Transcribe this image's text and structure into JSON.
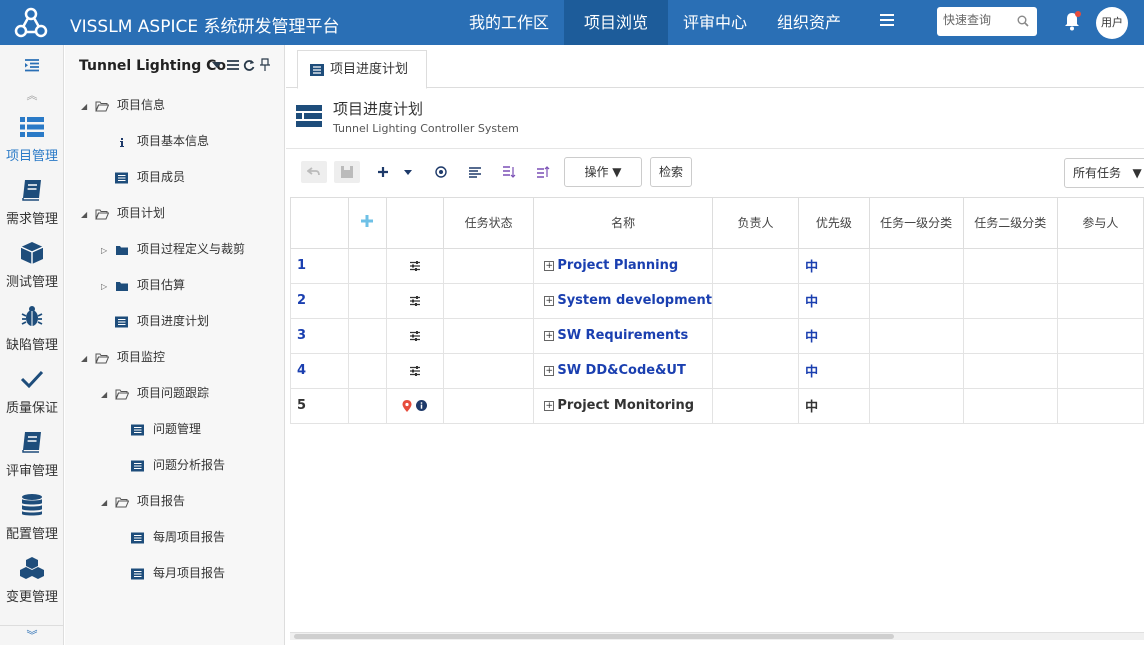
{
  "app": {
    "title": "VISSLM ASPICE 系统研发管理平台"
  },
  "nav": [
    {
      "label": "我的工作区",
      "active": false
    },
    {
      "label": "项目浏览",
      "active": true
    },
    {
      "label": "评审中心",
      "active": false
    },
    {
      "label": "组织资产",
      "active": false
    }
  ],
  "search": {
    "placeholder": "快速查询"
  },
  "user": {
    "label": "用户"
  },
  "modules": [
    {
      "label": "项目管理",
      "icon": "list-icon",
      "active": true
    },
    {
      "label": "需求管理",
      "icon": "book-icon",
      "active": false
    },
    {
      "label": "测试管理",
      "icon": "cube-icon",
      "active": false
    },
    {
      "label": "缺陷管理",
      "icon": "bug-icon",
      "active": false
    },
    {
      "label": "质量保证",
      "icon": "check-icon",
      "active": false
    },
    {
      "label": "评审管理",
      "icon": "book-icon",
      "active": false
    },
    {
      "label": "配置管理",
      "icon": "database-icon",
      "active": false
    },
    {
      "label": "变更管理",
      "icon": "cubes-icon",
      "active": false
    }
  ],
  "tree": {
    "project_name": "Tunnel Lighting Co",
    "nodes": [
      {
        "label": "项目信息",
        "level": 0,
        "arrow": "expanded",
        "icon": "folder-open-icon"
      },
      {
        "label": "项目基本信息",
        "level": 1,
        "arrow": "none",
        "icon": "info-icon"
      },
      {
        "label": "项目成员",
        "level": 1,
        "arrow": "none",
        "icon": "doc-list-icon"
      },
      {
        "label": "项目计划",
        "level": 0,
        "arrow": "expanded",
        "icon": "folder-open-icon"
      },
      {
        "label": "项目过程定义与裁剪",
        "level": 1,
        "arrow": "collapsed",
        "icon": "folder-icon"
      },
      {
        "label": "项目估算",
        "level": 1,
        "arrow": "collapsed",
        "icon": "folder-icon"
      },
      {
        "label": "项目进度计划",
        "level": 1,
        "arrow": "none",
        "icon": "doc-list-icon"
      },
      {
        "label": "项目监控",
        "level": 0,
        "arrow": "expanded",
        "icon": "folder-open-icon"
      },
      {
        "label": "项目问题跟踪",
        "level": 1,
        "arrow": "expanded",
        "icon": "folder-open-icon"
      },
      {
        "label": "问题管理",
        "level": 2,
        "arrow": "none",
        "icon": "doc-list-icon"
      },
      {
        "label": "问题分析报告",
        "level": 2,
        "arrow": "none",
        "icon": "doc-list-icon"
      },
      {
        "label": "项目报告",
        "level": 1,
        "arrow": "expanded",
        "icon": "folder-open-icon"
      },
      {
        "label": "每周项目报告",
        "level": 2,
        "arrow": "none",
        "icon": "doc-list-icon"
      },
      {
        "label": "每月项目报告",
        "level": 2,
        "arrow": "none",
        "icon": "doc-list-icon"
      }
    ]
  },
  "tab": {
    "label": "项目进度计划"
  },
  "page": {
    "title": "项目进度计划",
    "subtitle": "Tunnel Lighting Controller System"
  },
  "toolbar": {
    "operate_label": "操作",
    "search_label": "检索",
    "filter_label": "所有任务"
  },
  "table": {
    "headers": [
      "任务状态",
      "名称",
      "负责人",
      "优先级",
      "任务一级分类",
      "任务二级分类",
      "参与人"
    ],
    "rows": [
      {
        "num": "1",
        "name": "Project Planning",
        "priority": "中",
        "highlight": true,
        "icons": "settings"
      },
      {
        "num": "2",
        "name": "System development",
        "priority": "中",
        "highlight": true,
        "icons": "settings"
      },
      {
        "num": "3",
        "name": "SW Requirements",
        "priority": "中",
        "highlight": true,
        "icons": "settings"
      },
      {
        "num": "4",
        "name": "SW DD&Code&UT",
        "priority": "中",
        "highlight": true,
        "icons": "settings"
      },
      {
        "num": "5",
        "name": "Project Monitoring",
        "priority": "中",
        "highlight": false,
        "icons": "pin-info"
      }
    ]
  }
}
